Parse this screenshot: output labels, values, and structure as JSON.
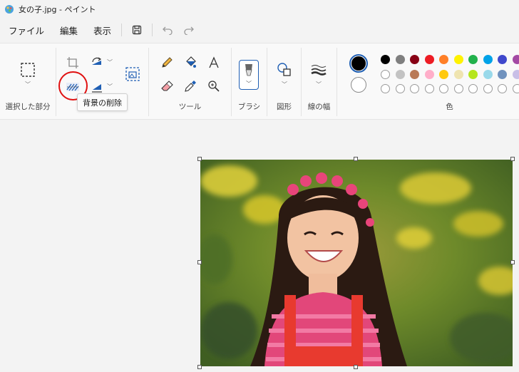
{
  "window": {
    "title": "女の子.jpg - ペイント"
  },
  "menu": {
    "file": "ファイル",
    "edit": "編集",
    "view": "表示"
  },
  "ribbon": {
    "selection_label": "選択した部分",
    "tools_label": "ツール",
    "brush_label": "ブラシ",
    "shapes_label": "図形",
    "stroke_label": "線の幅",
    "colors_label": "色"
  },
  "tooltip": {
    "remove_background": "背景の削除"
  },
  "colors": {
    "primary": "#000000",
    "secondary": "#ffffff",
    "row1": [
      "#000000",
      "#7f7f7f",
      "#880015",
      "#ed1c24",
      "#ff7f27",
      "#fff200",
      "#22b14c",
      "#00a2e8",
      "#3f48cc",
      "#a349a4"
    ],
    "row2": [
      "#ffffff",
      "#c3c3c3",
      "#b97a57",
      "#ffaec9",
      "#ffc90e",
      "#efe4b0",
      "#b5e61d",
      "#99d9ea",
      "#7092be",
      "#c8bfe7"
    ],
    "row3": [
      "empty",
      "empty",
      "empty",
      "empty",
      "empty",
      "empty",
      "empty",
      "empty",
      "empty",
      "empty"
    ],
    "highlight": "#e01010"
  }
}
